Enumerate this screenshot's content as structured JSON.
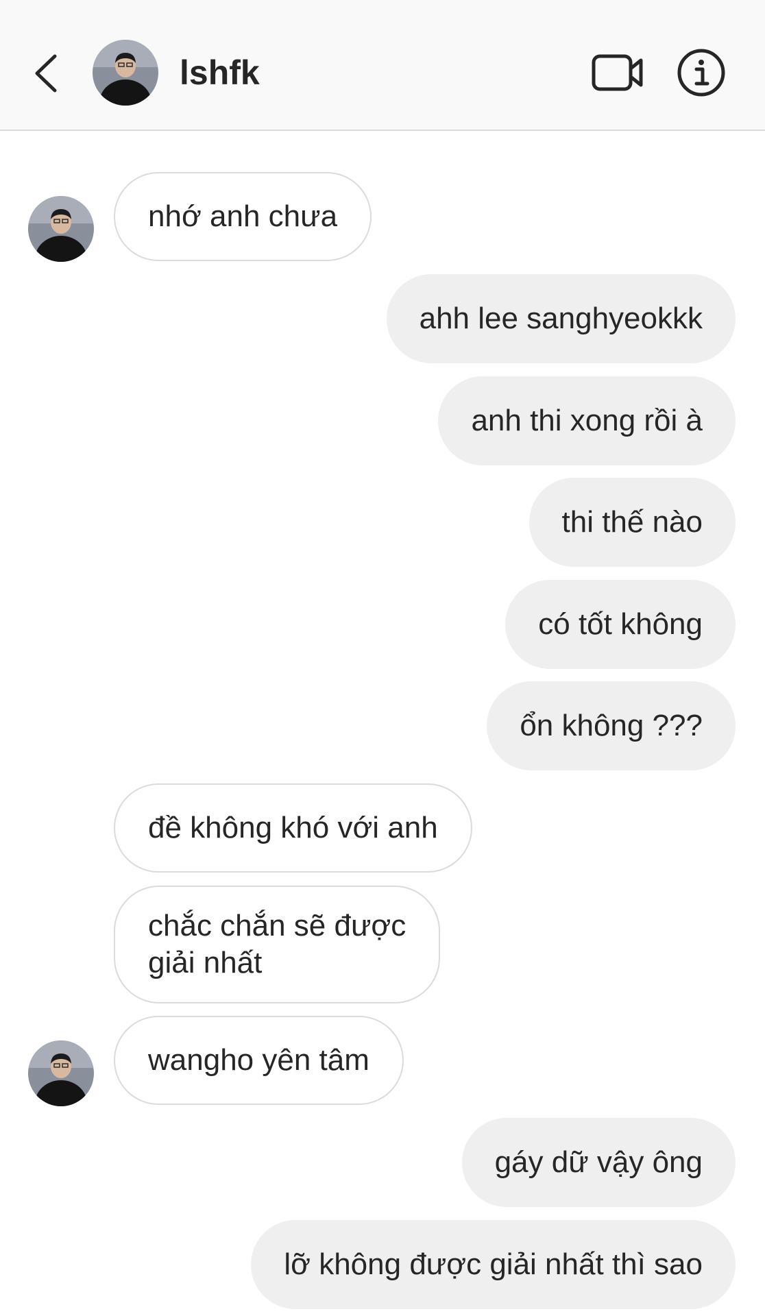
{
  "header": {
    "username": "lshfk"
  },
  "messages": [
    {
      "side": "in",
      "text": "nhớ anh chưa"
    },
    {
      "side": "out",
      "text": "ahh lee sanghyeokkk"
    },
    {
      "side": "out",
      "text": "anh thi xong rồi à"
    },
    {
      "side": "out",
      "text": "thi thế nào"
    },
    {
      "side": "out",
      "text": "có tốt không"
    },
    {
      "side": "out",
      "text": "ổn không ???"
    },
    {
      "side": "in",
      "text": "đề không khó với anh"
    },
    {
      "side": "in",
      "text": "chắc chắn sẽ được giải nhất",
      "lines": [
        "chắc chắn sẽ được",
        "giải nhất"
      ]
    },
    {
      "side": "in",
      "text": "wangho yên tâm"
    },
    {
      "side": "out",
      "text": "gáy dữ vậy ông"
    },
    {
      "side": "out",
      "text": "lỡ không được giải nhất thì sao"
    }
  ]
}
